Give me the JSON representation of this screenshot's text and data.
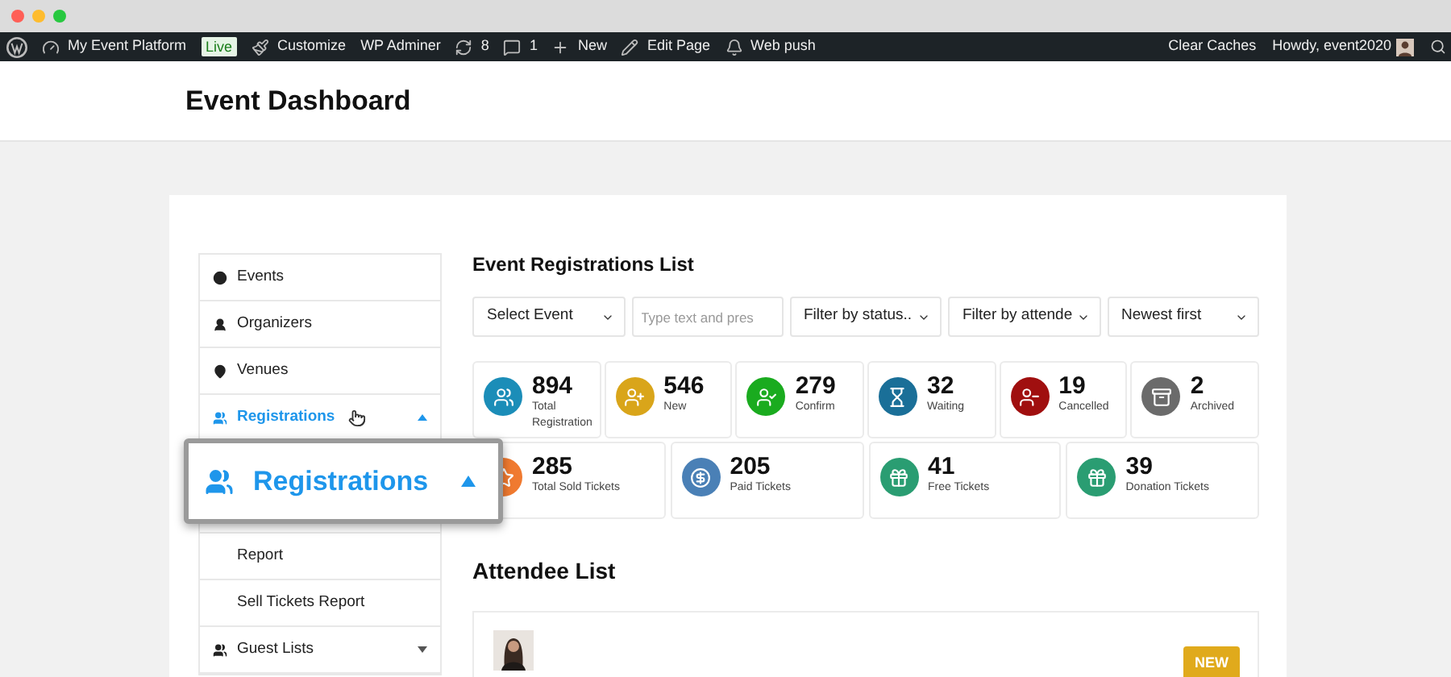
{
  "admin_bar": {
    "left": [
      {
        "kind": "wp"
      },
      {
        "kind": "site",
        "label": "My Event Platform"
      },
      {
        "kind": "badge",
        "label": "Live"
      },
      {
        "kind": "brush",
        "label": "Customize"
      },
      {
        "kind": "plain",
        "label": "WP Adminer"
      },
      {
        "kind": "updates",
        "label": "8"
      },
      {
        "kind": "comments",
        "label": "1"
      },
      {
        "kind": "new",
        "label": "New"
      },
      {
        "kind": "edit",
        "label": "Edit Page"
      },
      {
        "kind": "bell",
        "label": "Web push"
      }
    ],
    "right": [
      "Clear Caches",
      "Howdy, event2020"
    ]
  },
  "page_title": "Event Dashboard",
  "sidebar": {
    "items": [
      {
        "kind": "events",
        "label": "Events",
        "selected": false
      },
      {
        "kind": "organizers",
        "label": "Organizers",
        "selected": false
      },
      {
        "kind": "venues",
        "label": "Venues",
        "selected": false
      },
      {
        "kind": "registrations",
        "label": "Registrations",
        "selected": true,
        "expanded": true
      },
      {
        "kind": "sub",
        "label": "Report",
        "selected": false
      },
      {
        "kind": "sub",
        "label": "Sell Tickets Report",
        "selected": false
      },
      {
        "kind": "guests",
        "label": "Guest Lists",
        "selected": false,
        "expanded": false
      }
    ],
    "callout": {
      "label": "Registrations"
    }
  },
  "registrations": {
    "title": "Event Registrations List",
    "filters": [
      {
        "kind": "select",
        "label": "Select Event"
      },
      {
        "kind": "input",
        "placeholder": "Type text and pres"
      },
      {
        "kind": "select",
        "label": "Filter by status.."
      },
      {
        "kind": "select",
        "label": "Filter by attende"
      },
      {
        "kind": "select",
        "label": "Newest first"
      }
    ],
    "stats_row_1": [
      {
        "kind": "users",
        "value": "894",
        "label": "Total Registration",
        "color": "#1b8db8"
      },
      {
        "kind": "user-plus",
        "value": "546",
        "label": "New",
        "color": "#d9a51a"
      },
      {
        "kind": "user-check",
        "value": "279",
        "label": "Confirm",
        "color": "#1aab1f"
      },
      {
        "kind": "hourglass",
        "value": "32",
        "label": "Waiting",
        "color": "#1a6f98"
      },
      {
        "kind": "user-minus",
        "value": "19",
        "label": "Cancelled",
        "color": "#a00f0f"
      },
      {
        "kind": "archive",
        "value": "2",
        "label": "Archived",
        "color": "#6b6b6b"
      }
    ],
    "stats_row_2": [
      {
        "kind": "star",
        "value": "285",
        "label": "Total Sold Tickets",
        "color": "#f07a30"
      },
      {
        "kind": "dollar",
        "value": "205",
        "label": "Paid Tickets",
        "color": "#4a80b6"
      },
      {
        "kind": "gift",
        "value": "41",
        "label": "Free Tickets",
        "color": "#2a9d72"
      },
      {
        "kind": "gift",
        "value": "39",
        "label": "Donation Tickets",
        "color": "#2a9d72"
      }
    ]
  },
  "attendees": {
    "title": "Attendee List",
    "rows": [
      {
        "kind": "picture",
        "badge": "NEW"
      }
    ]
  }
}
